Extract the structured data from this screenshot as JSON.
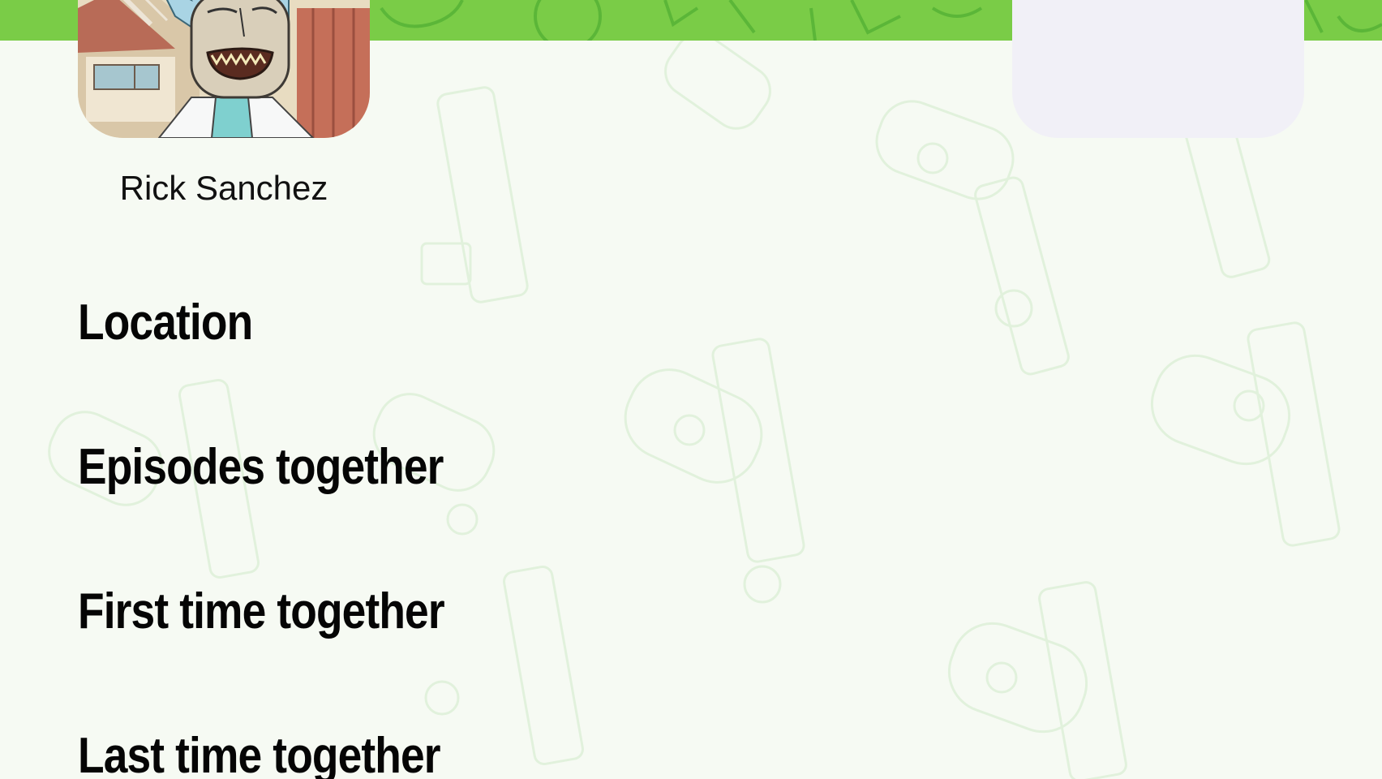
{
  "character": {
    "name": "Rick Sanchez",
    "avatar_icon": "rick-sanchez-portrait"
  },
  "sections": [
    {
      "label": "Location"
    },
    {
      "label": "Episodes together"
    },
    {
      "label": "First time together"
    },
    {
      "label": "Last time together"
    }
  ],
  "colors": {
    "accent_green": "#7acc47",
    "background": "#f6faf3",
    "card_placeholder": "#f1f0f7"
  }
}
